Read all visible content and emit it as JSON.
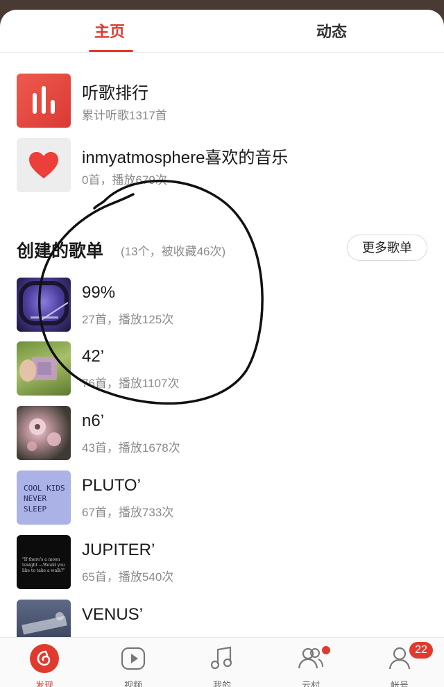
{
  "tabs": [
    {
      "label": "主页",
      "active": true
    },
    {
      "label": "动态",
      "active": false
    }
  ],
  "accent_color": "#e03a2f",
  "top_items": [
    {
      "title": "听歌排行",
      "subtitle": "累计听歌1317首",
      "icon": "bar-chart-icon"
    },
    {
      "title": "inmyatmosphere喜欢的音乐",
      "subtitle": "0首，播放679次",
      "icon": "heart-icon"
    }
  ],
  "section": {
    "title": "创建的歌单",
    "meta": "(13个，被收藏46次)",
    "more_label": "更多歌单"
  },
  "playlists": [
    {
      "title": "99%",
      "subtitle": "27首，播放125次"
    },
    {
      "title": "42’",
      "subtitle": "76首，播放1107次"
    },
    {
      "title": "n6’",
      "subtitle": "43首，播放1678次"
    },
    {
      "title": "PLUTO’",
      "subtitle": "67首，播放733次",
      "cover_text": "COOL KIDS NEVER SLEEP"
    },
    {
      "title": "JUPITER’",
      "subtitle": "65首，播放540次",
      "cover_text": "\"If there's a moon tonight —Would you like to take a walk?\""
    },
    {
      "title": "VENUS’",
      "subtitle": ""
    }
  ],
  "bottom_nav": [
    {
      "label": "发现",
      "icon": "netease-logo-icon",
      "active": true
    },
    {
      "label": "视频",
      "icon": "video-play-icon",
      "active": false
    },
    {
      "label": "我的",
      "icon": "music-note-icon",
      "active": false
    },
    {
      "label": "云村",
      "icon": "people-icon",
      "active": false,
      "dot": true
    },
    {
      "label": "帐号",
      "icon": "user-icon",
      "active": false,
      "badge": "22"
    }
  ]
}
